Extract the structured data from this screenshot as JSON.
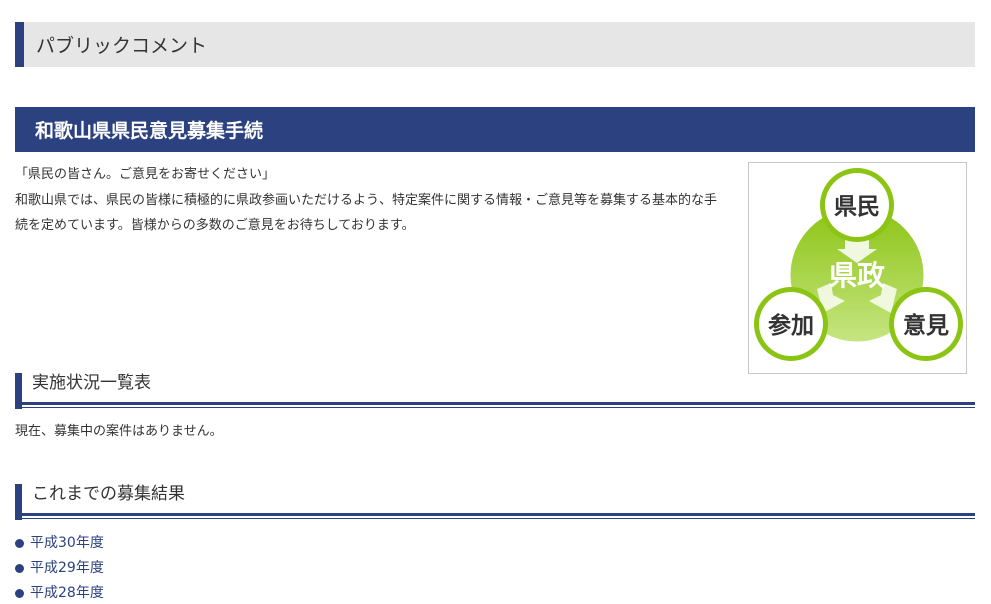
{
  "header": {
    "title": "パブリックコメント"
  },
  "banner": {
    "title": "和歌山県県民意見募集手続"
  },
  "intro": {
    "lead": "「県民の皆さん。ご意見をお寄せください」",
    "line1": "和歌山県では、県民の皆様に積極的に県政参画いただけるよう、特定案件に関する情報・ご意見等を募集する基本的な手",
    "line2": "続を定めています。皆様からの多数のご意見をお待ちしております。"
  },
  "logo": {
    "center": "県政",
    "top": "県民",
    "left": "参加",
    "right": "意見",
    "colors": {
      "green": "#8cc414",
      "green_light": "#c6e582",
      "text_dark": "#333333"
    }
  },
  "section_status": {
    "title": "実施状況一覧表",
    "message": "現在、募集中の案件はありません。"
  },
  "section_results": {
    "title": "これまでの募集結果",
    "items": [
      {
        "label": "平成30年度"
      },
      {
        "label": "平成29年度"
      },
      {
        "label": "平成28年度"
      }
    ]
  },
  "colors": {
    "accent": "#2c4280",
    "header_bg": "#e6e6e6"
  }
}
